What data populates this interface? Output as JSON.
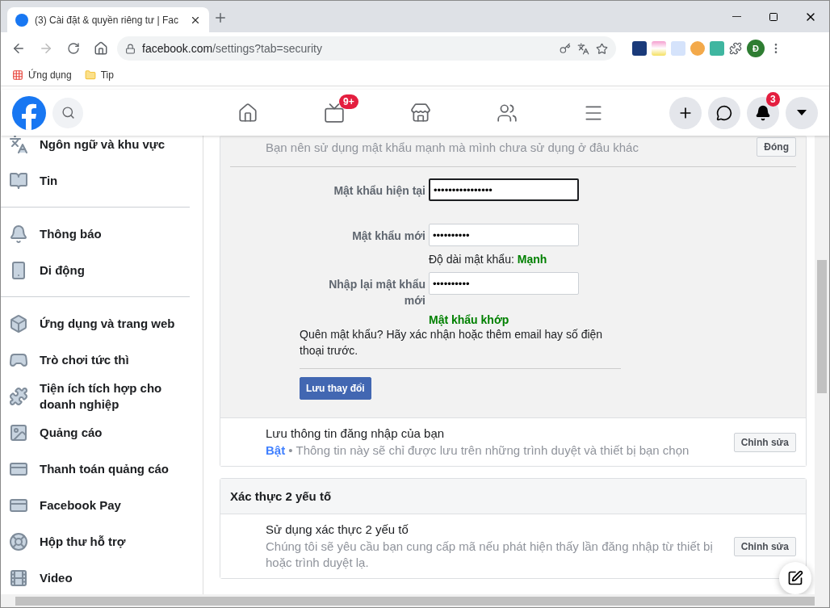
{
  "browser": {
    "tab_title": "(3) Cài đặt & quyền riêng tư | Fac",
    "address": {
      "domain": "facebook.com",
      "path": "/settings?tab=security"
    },
    "bookmarks": [
      {
        "kind": "apps",
        "label": "Ứng dụng"
      },
      {
        "kind": "folder",
        "label": "Tip"
      }
    ],
    "profile_initial": "Đ"
  },
  "header": {
    "nav": [
      {
        "kind": "home"
      },
      {
        "kind": "watch",
        "badge": "9+"
      },
      {
        "kind": "marketplace"
      },
      {
        "kind": "groups"
      },
      {
        "kind": "menu"
      }
    ],
    "actions": [
      {
        "kind": "create"
      },
      {
        "kind": "messenger"
      },
      {
        "kind": "notifications",
        "badge": "3"
      },
      {
        "kind": "account"
      }
    ]
  },
  "sidebar": {
    "groups": [
      {
        "items": [
          {
            "kind": "language",
            "label": "Ngôn ngữ và khu vực"
          },
          {
            "kind": "news",
            "label": "Tin"
          }
        ]
      },
      {
        "items": [
          {
            "kind": "notifications",
            "label": "Thông báo"
          },
          {
            "kind": "mobile",
            "label": "Di động"
          }
        ]
      },
      {
        "items": [
          {
            "kind": "apps",
            "label": "Ứng dụng và trang web"
          },
          {
            "kind": "games",
            "label": "Trò chơi tức thì"
          },
          {
            "kind": "integrations",
            "label": "Tiện ích tích hợp cho doanh nghiệp"
          },
          {
            "kind": "ads",
            "label": "Quảng cáo"
          },
          {
            "kind": "payments",
            "label": "Thanh toán quảng cáo"
          },
          {
            "kind": "pay",
            "label": "Facebook Pay"
          },
          {
            "kind": "support",
            "label": "Hộp thư hỗ trợ"
          },
          {
            "kind": "video",
            "label": "Video"
          }
        ]
      }
    ]
  },
  "password_section": {
    "hint": "Bạn nên sử dụng mật khẩu mạnh mà mình chưa sử dụng ở đâu khác",
    "close_button": "Đóng",
    "fields": [
      {
        "label": "Mật khẩu hiện tại",
        "value": "••••••••••••••••",
        "focused": true
      },
      {
        "label": "Mật khẩu mới",
        "value": "••••••••••",
        "focused": false,
        "note": "Độ dài mật khẩu:",
        "strength": "Mạnh"
      },
      {
        "label": "Nhập lại mật khẩu mới",
        "value": "••••••••••",
        "focused": false,
        "status": "Mật khẩu khớp"
      }
    ],
    "forgot": "Quên mật khẩu? Hãy xác nhận hoặc thêm email hay số điện thoại trước.",
    "save_button": "Lưu thay đổi"
  },
  "save_login": {
    "title": "Lưu thông tin đăng nhập của bạn",
    "description": "**Bật** • Thông tin này sẽ chỉ được lưu trên những trình duyệt và thiết bị bạn chọn",
    "button": "Chỉnh sửa"
  },
  "two_factor": {
    "heading": "Xác thực 2 yếu tố",
    "rows": [
      {
        "title": "Sử dụng xác thực 2 yếu tố",
        "description": "Chúng tôi sẽ yêu cầu bạn cung cấp mã nếu phát hiện thấy lần đăng nhập từ thiết bị hoặc trình duyệt lạ.",
        "button": "Chỉnh sửa"
      }
    ]
  }
}
